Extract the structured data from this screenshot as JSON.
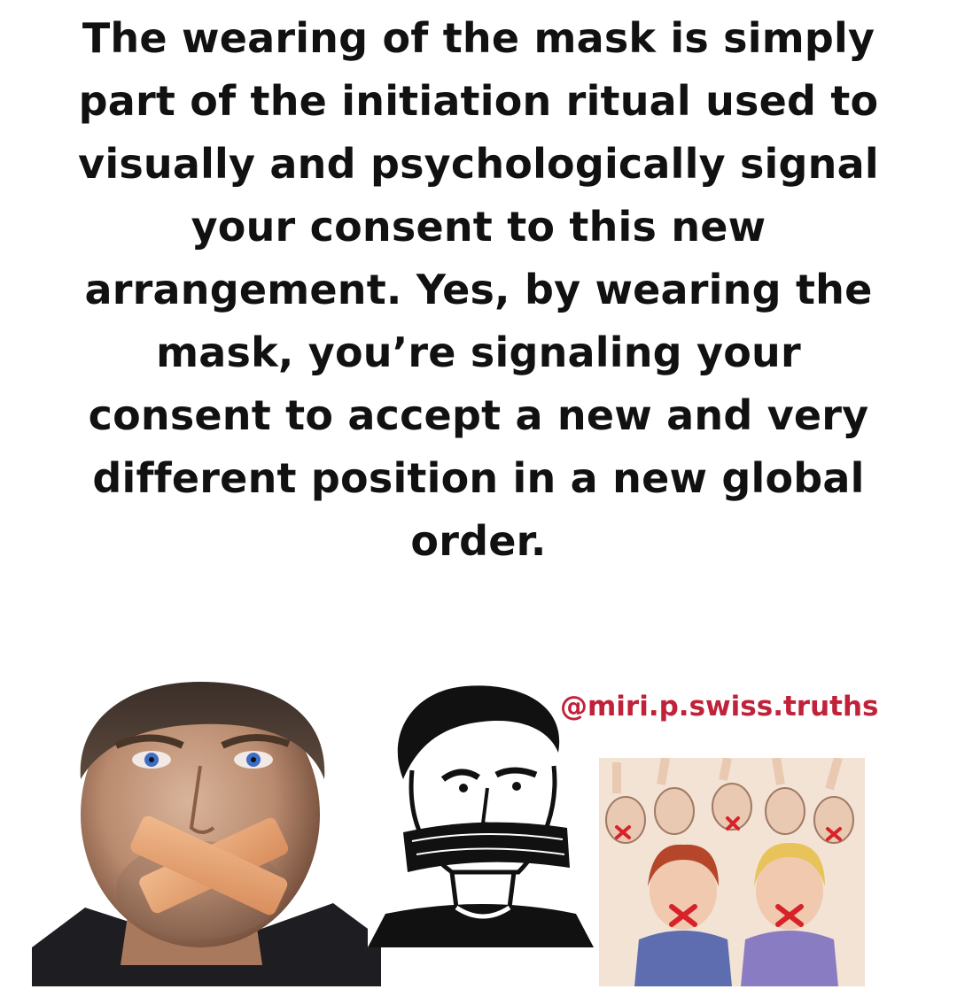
{
  "quote": {
    "lines": [
      "The wearing of the mask is simply",
      "part of the initiation ritual used to",
      "visually and psychologically signal",
      "your consent to this new",
      "arrangement.  Yes, by wearing the",
      "mask, you’re signaling your",
      "consent to accept a new and very",
      "different position in a new global",
      "order."
    ]
  },
  "watermark": {
    "handle": "@miri.p.swiss.truths",
    "color": "#c0223a"
  },
  "images": [
    {
      "icon": "taped-mouth-man-photo"
    },
    {
      "icon": "gagged-man-sketch"
    },
    {
      "icon": "silenced-crowd-illustration"
    }
  ],
  "colors": {
    "background": "#ffffff",
    "text": "#111111",
    "tape": "#e8a878",
    "x_mark": "#d8222a"
  }
}
